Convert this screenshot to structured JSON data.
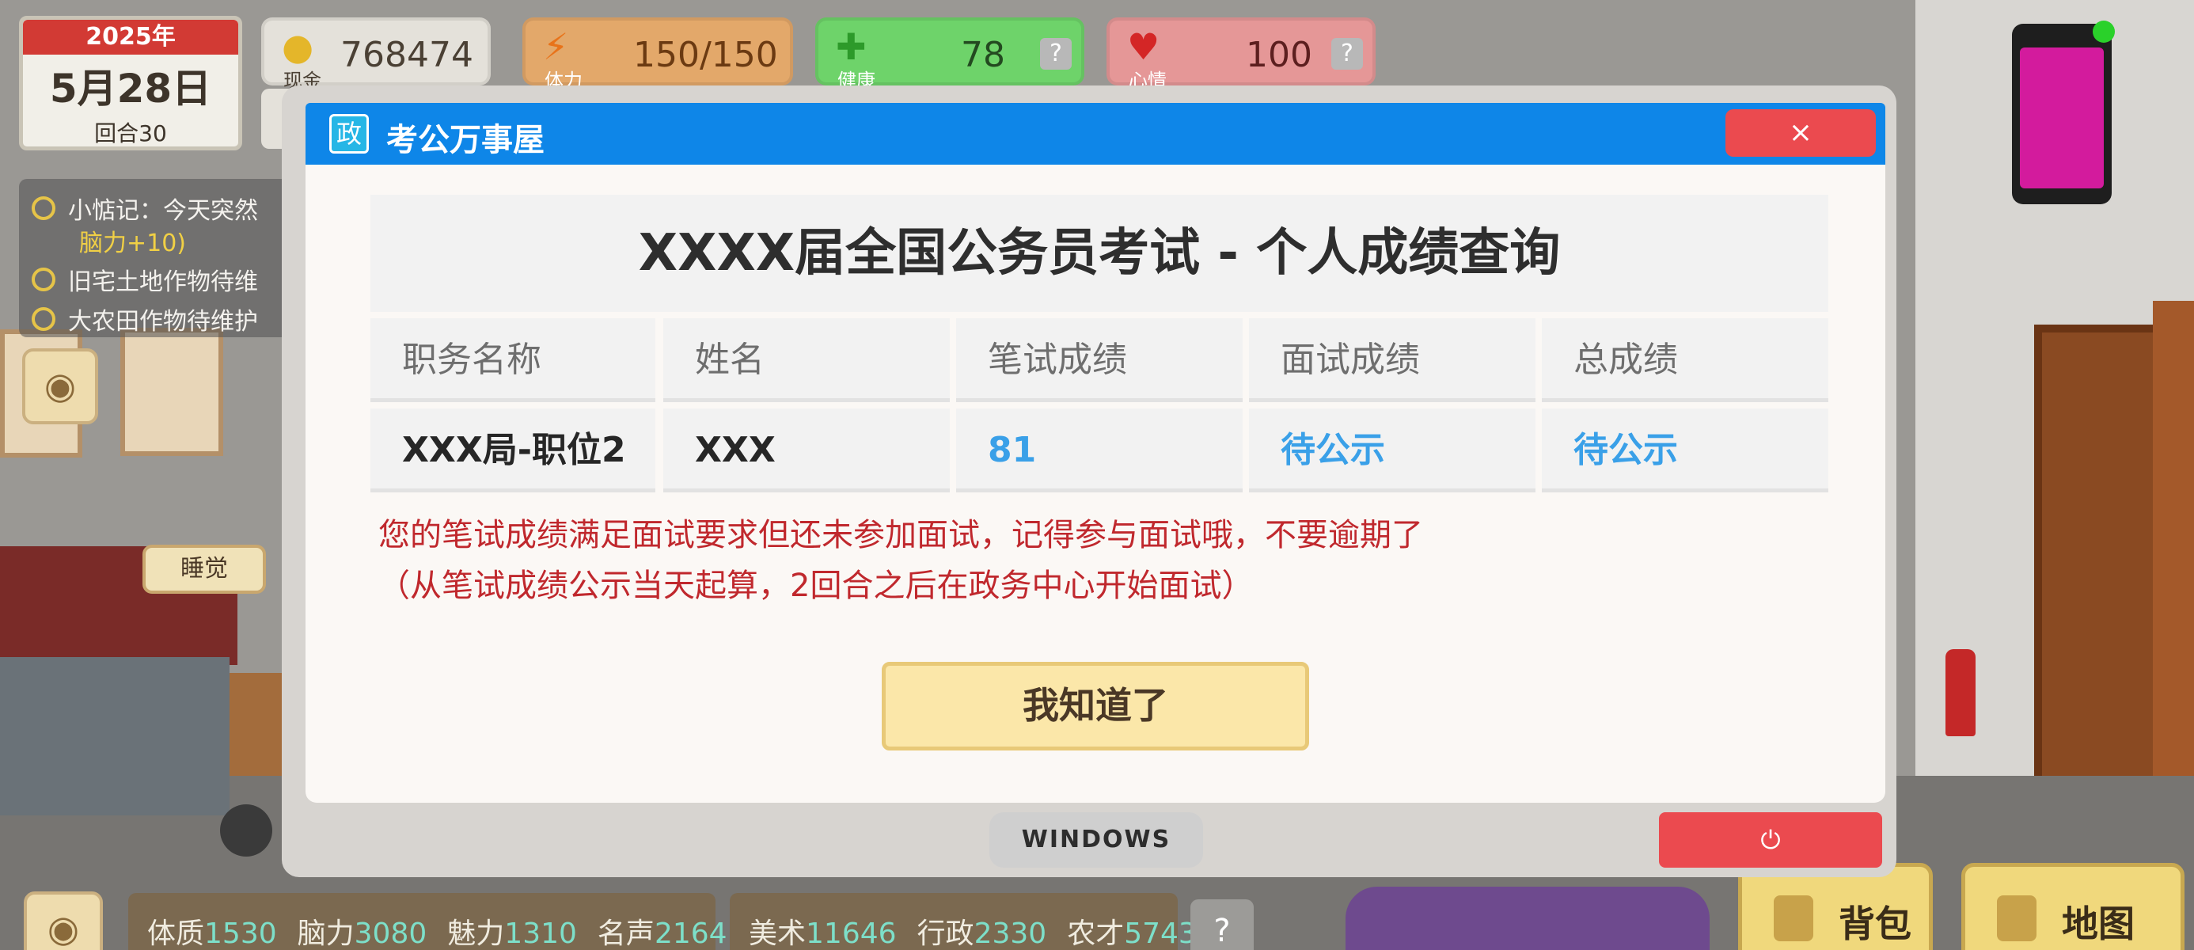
{
  "hud": {
    "date": {
      "year": "2025年",
      "month_day": "5月28日",
      "round": "回合30"
    },
    "cash": {
      "label": "现金",
      "value": "768474",
      "icon": "coin-icon"
    },
    "stamina": {
      "label": "体力",
      "value": "150/150",
      "icon": "lightning-icon"
    },
    "health": {
      "label": "健康",
      "value": "78",
      "icon": "cross-icon",
      "help": "?"
    },
    "mood": {
      "label": "心情",
      "value": "100",
      "icon": "heart-icon",
      "help": "?"
    }
  },
  "tasks": [
    {
      "text": "小惦记：今天突然"
    },
    {
      "text": "脑力+10)"
    },
    {
      "text": "旧宅土地作物待维"
    },
    {
      "text": "大农田作物待维护"
    }
  ],
  "scene": {
    "sleep_label": "睡觉"
  },
  "dialog": {
    "window_title": "考公万事屋",
    "title_icon_char": "政",
    "close_label": "×",
    "sheet_title": "XXXX届全国公务员考试 - 个人成绩查询",
    "columns": [
      "职务名称",
      "姓名",
      "笔试成绩",
      "面试成绩",
      "总成绩"
    ],
    "row": [
      "XXX局-职位2",
      "XXX",
      "81",
      "待公示",
      "待公示"
    ],
    "notice_line1": "您的笔试成绩满足面试要求但还未参加面试，记得参与面试哦，不要逾期了",
    "notice_line2": "（从笔试成绩公示当天起算，2回合之后在政务中心开始面试）",
    "ok_label": "我知道了"
  },
  "taskbar": {
    "windows_label": "WINDOWS",
    "power_label": "⏻"
  },
  "bottom": {
    "stats1": [
      {
        "label": "体质",
        "value": "1530"
      },
      {
        "label": "脑力",
        "value": "3080"
      },
      {
        "label": "魅力",
        "value": "1310"
      },
      {
        "label": "名声",
        "value": "2164"
      }
    ],
    "stats2": [
      {
        "label": "美术",
        "value": "11646"
      },
      {
        "label": "行政",
        "value": "2330"
      },
      {
        "label": "农才",
        "value": "5743"
      }
    ],
    "help": "?",
    "bag_label": "背包",
    "map_label": "地图"
  },
  "colors": {
    "titlebar": "#0e86e8",
    "close": "#eb4a4f",
    "notice": "#c0282d",
    "score_blue": "#3aa0e8",
    "ok_button": "#fbe7a9"
  }
}
